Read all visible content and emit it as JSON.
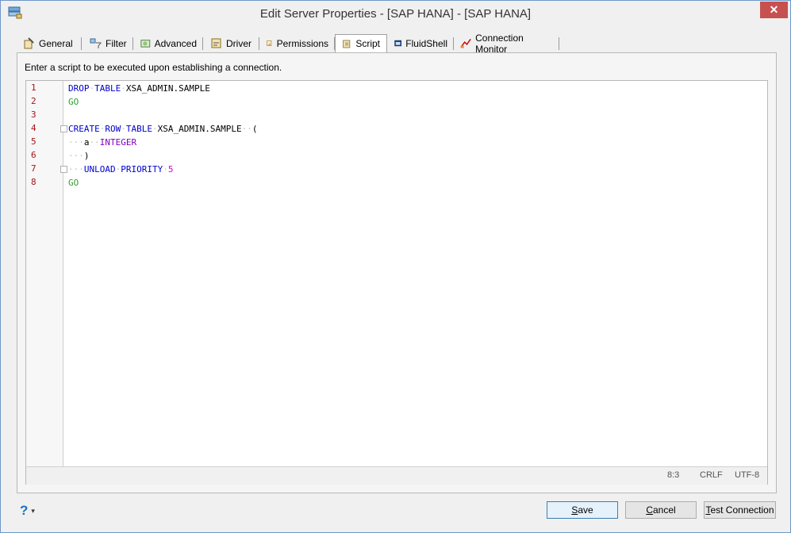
{
  "window": {
    "title": "Edit Server Properties - [SAP HANA] - [SAP HANA]",
    "close_label": "✕"
  },
  "tabs": [
    {
      "label": "General",
      "icon": "general-icon"
    },
    {
      "label": "Filter",
      "icon": "filter-icon"
    },
    {
      "label": "Advanced",
      "icon": "advanced-icon"
    },
    {
      "label": "Driver",
      "icon": "driver-icon"
    },
    {
      "label": "Permissions",
      "icon": "permissions-icon"
    },
    {
      "label": "Script",
      "icon": "script-icon",
      "active": true
    },
    {
      "label": "FluidShell",
      "icon": "fluidshell-icon"
    },
    {
      "label": "Connection Monitor",
      "icon": "connection-monitor-icon"
    }
  ],
  "panel": {
    "instructions": "Enter a script to be executed upon establishing a connection."
  },
  "editor": {
    "line_numbers": [
      "1",
      "2",
      "3",
      "4",
      "5",
      "6",
      "7",
      "8"
    ],
    "code": {
      "l1": {
        "t1": "DROP",
        "t2": "TABLE",
        "t3": "XSA_ADMIN.SAMPLE"
      },
      "l2": {
        "t1": "GO"
      },
      "l4": {
        "t1": "CREATE",
        "t2": "ROW",
        "t3": "TABLE",
        "t4": "XSA_ADMIN.SAMPLE",
        "t5": "("
      },
      "l5": {
        "t1": "a",
        "t2": "INTEGER"
      },
      "l6": {
        "t1": ")"
      },
      "l7": {
        "t1": "UNLOAD",
        "t2": "PRIORITY",
        "t3": "5"
      },
      "l8": {
        "t1": "GO"
      }
    },
    "status": {
      "position": "8:3",
      "line_ending": "CRLF",
      "encoding": "UTF-8"
    }
  },
  "footer": {
    "help_icon": "?",
    "help_caret": "▾",
    "save_label_u": "S",
    "save_label_rest": "ave",
    "cancel_label_u": "C",
    "cancel_label_rest": "ancel",
    "test_label_u": "T",
    "test_label_rest": "est Connection"
  },
  "colors": {
    "keyword": "#0000cc",
    "go": "#2ea02e",
    "type": "#8000c0",
    "number": "#d000d0",
    "close": "#c75050"
  }
}
